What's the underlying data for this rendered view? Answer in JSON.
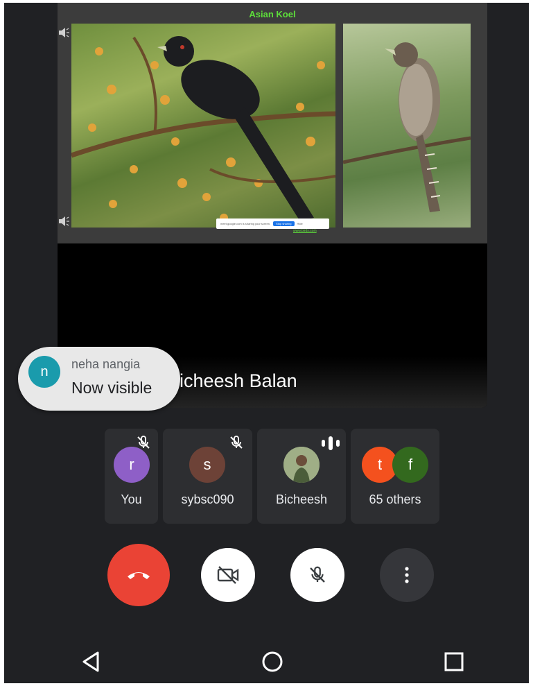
{
  "slide": {
    "title": "Asian Koel",
    "share_banner_text": "meet.google.com is sharing your screen.",
    "stop_sharing_label": "Stop sharing",
    "hide_label": "Hide",
    "source_link": "www.birds.com"
  },
  "presenter": {
    "name": "Bicheesh Balan"
  },
  "toast": {
    "avatar_letter": "n",
    "name": "neha nangia",
    "status": "Now visible"
  },
  "participants": [
    {
      "label": "You",
      "avatar_letter": "r",
      "avatar_color": "#8e5fc7",
      "muted": true
    },
    {
      "label": "sybsc090",
      "avatar_letter": "s",
      "avatar_color": "#6d4237",
      "muted": true
    },
    {
      "label": "Bicheesh",
      "avatar_letter": "",
      "avatar_color": "#8a9a78",
      "muted": false,
      "speaking": true
    },
    {
      "label": "65 others",
      "avatar_letters": [
        "t",
        "f"
      ],
      "avatar_colors": [
        "#f4511e",
        "#33691e"
      ]
    }
  ],
  "controls": {
    "end_call_color": "#ea4335"
  },
  "colors": {
    "background": "#202124",
    "tile": "#2d2e31",
    "title_green": "#5dde3a"
  }
}
